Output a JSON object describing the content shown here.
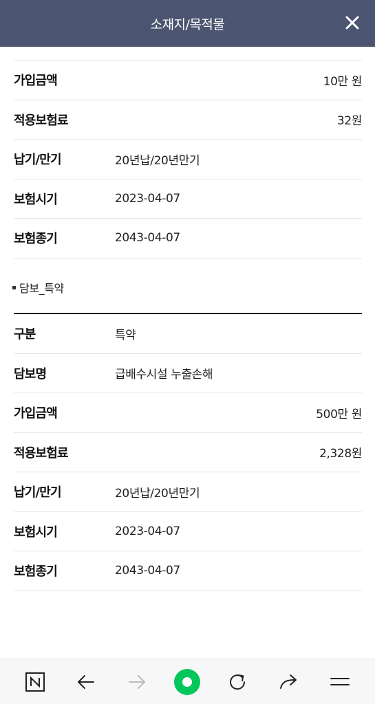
{
  "header": {
    "title": "소재지/목적물",
    "close_icon": "close-icon"
  },
  "first_table": {
    "rows": [
      {
        "label": "가입금액",
        "value": "10만 원",
        "align": "right"
      },
      {
        "label": "적용보험료",
        "value": "32원",
        "align": "right"
      },
      {
        "label": "납기/만기",
        "value": "20년납/20년만기",
        "align": "left"
      },
      {
        "label": "보험시기",
        "value": "2023-04-07",
        "align": "left"
      },
      {
        "label": "보험종기",
        "value": "2043-04-07",
        "align": "left"
      }
    ]
  },
  "section": {
    "title": "담보_특약"
  },
  "second_table": {
    "rows": [
      {
        "label": "구분",
        "value": "특약",
        "align": "left"
      },
      {
        "label": "담보명",
        "value": "급배수시설 누출손해",
        "align": "left"
      },
      {
        "label": "가입금액",
        "value": "500만 원",
        "align": "right"
      },
      {
        "label": "적용보험료",
        "value": "2,328원",
        "align": "right"
      },
      {
        "label": "납기/만기",
        "value": "20년납/20년만기",
        "align": "left"
      },
      {
        "label": "보험시기",
        "value": "2023-04-07",
        "align": "left"
      },
      {
        "label": "보험종기",
        "value": "2043-04-07",
        "align": "left"
      }
    ]
  },
  "bottom_nav": {
    "items": [
      "naver-home-icon",
      "back-arrow-icon",
      "forward-arrow-icon",
      "green-dot-icon",
      "refresh-icon",
      "share-icon",
      "menu-icon"
    ],
    "accent_color": "#03c75a"
  }
}
